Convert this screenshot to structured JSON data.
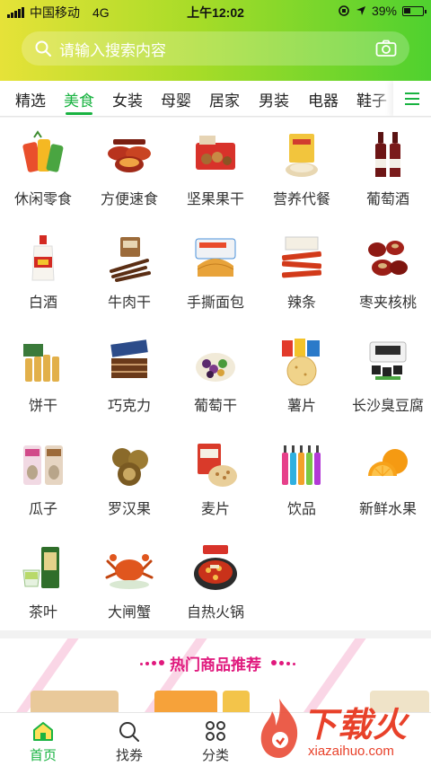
{
  "status": {
    "carrier": "中国移动",
    "network": "4G",
    "time": "上午12:02",
    "battery": "39%",
    "battery_level": 0.39
  },
  "search": {
    "placeholder": "请输入搜索内容"
  },
  "tabs": [
    {
      "label": "精选",
      "active": false
    },
    {
      "label": "美食",
      "active": true
    },
    {
      "label": "女装",
      "active": false
    },
    {
      "label": "母婴",
      "active": false
    },
    {
      "label": "居家",
      "active": false
    },
    {
      "label": "男装",
      "active": false
    },
    {
      "label": "电器",
      "active": false
    },
    {
      "label": "鞋子",
      "active": false
    }
  ],
  "categories": [
    {
      "label": "休闲零食",
      "icon": "snacks-icon"
    },
    {
      "label": "方便速食",
      "icon": "instant-noodles-icon"
    },
    {
      "label": "坚果果干",
      "icon": "nuts-icon"
    },
    {
      "label": "营养代餐",
      "icon": "meal-replacement-icon"
    },
    {
      "label": "葡萄酒",
      "icon": "wine-icon"
    },
    {
      "label": "白酒",
      "icon": "baijiu-icon"
    },
    {
      "label": "牛肉干",
      "icon": "beef-jerky-icon"
    },
    {
      "label": "手撕面包",
      "icon": "bread-icon"
    },
    {
      "label": "辣条",
      "icon": "spicy-strips-icon"
    },
    {
      "label": "枣夹核桃",
      "icon": "dates-walnut-icon"
    },
    {
      "label": "饼干",
      "icon": "biscuit-icon"
    },
    {
      "label": "巧克力",
      "icon": "chocolate-icon"
    },
    {
      "label": "葡萄干",
      "icon": "raisin-icon"
    },
    {
      "label": "薯片",
      "icon": "chips-icon"
    },
    {
      "label": "长沙臭豆腐",
      "icon": "stinky-tofu-icon"
    },
    {
      "label": "瓜子",
      "icon": "sunflower-seeds-icon"
    },
    {
      "label": "罗汉果",
      "icon": "monk-fruit-icon"
    },
    {
      "label": "麦片",
      "icon": "oatmeal-icon"
    },
    {
      "label": "饮品",
      "icon": "drinks-icon"
    },
    {
      "label": "新鲜水果",
      "icon": "orange-icon"
    },
    {
      "label": "茶叶",
      "icon": "tea-icon"
    },
    {
      "label": "大闸蟹",
      "icon": "crab-icon"
    },
    {
      "label": "自热火锅",
      "icon": "hotpot-icon"
    }
  ],
  "hot": {
    "title": "热门商品推荐"
  },
  "nav": [
    {
      "label": "首页",
      "icon": "home-icon",
      "active": true
    },
    {
      "label": "找券",
      "icon": "search-coupon-icon",
      "active": false
    },
    {
      "label": "分类",
      "icon": "category-icon",
      "active": false
    }
  ],
  "watermark": {
    "brand": "下载火",
    "url": "xiazaihuo.com"
  },
  "colors": {
    "accent": "#19b341",
    "hot_pink": "#e0197d",
    "header_left": "#e6e238",
    "header_right": "#4fd12f"
  }
}
